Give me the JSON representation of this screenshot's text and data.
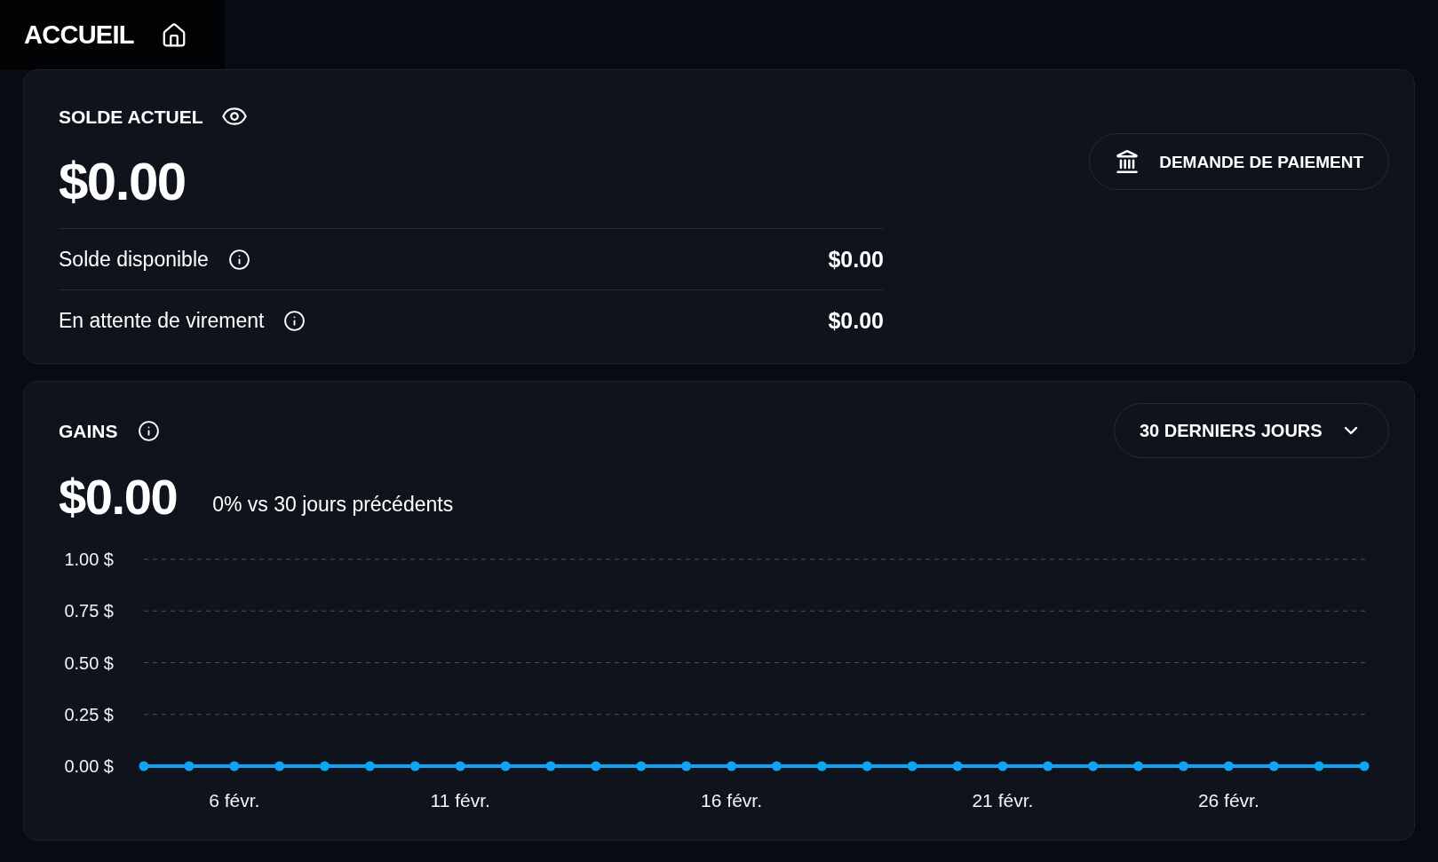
{
  "header": {
    "title": "ACCUEIL"
  },
  "balance_card": {
    "title": "SOLDE ACTUEL",
    "amount": "$0.00",
    "rows": [
      {
        "label": "Solde disponible",
        "value": "$0.00"
      },
      {
        "label": "En attente de virement",
        "value": "$0.00"
      }
    ],
    "button": "DEMANDE DE PAIEMENT"
  },
  "earnings_card": {
    "title": "GAINS",
    "period_dropdown": {
      "value": "30 DERNIERS JOURS"
    },
    "amount": "$0.00",
    "comparison": "0% vs 30 jours précédents",
    "chart_data": {
      "type": "line",
      "categories": [
        null,
        null,
        "6 févr.",
        null,
        null,
        null,
        null,
        "11 févr.",
        null,
        null,
        null,
        null,
        null,
        "16 févr.",
        null,
        null,
        null,
        null,
        null,
        "21 févr.",
        null,
        null,
        null,
        null,
        "26 févr.",
        null,
        null,
        null
      ],
      "series": [
        {
          "color": "#0ea5f5",
          "marker": "circle",
          "values": [
            0,
            0,
            0,
            0,
            0,
            0,
            0,
            0,
            0,
            0,
            0,
            0,
            0,
            0,
            0,
            0,
            0,
            0,
            0,
            0,
            0,
            0,
            0,
            0,
            0,
            0,
            0,
            0
          ]
        }
      ],
      "ylim": [
        0,
        1
      ],
      "yticks": [
        {
          "value": 1,
          "label": "1.00 $"
        },
        {
          "value": 0.75,
          "label": "0.75 $"
        },
        {
          "value": 0.5,
          "label": "0.50 $"
        },
        {
          "value": 0.25,
          "label": "0.25 $"
        },
        {
          "value": 0,
          "label": "0.00 $"
        }
      ],
      "grid": true
    }
  }
}
